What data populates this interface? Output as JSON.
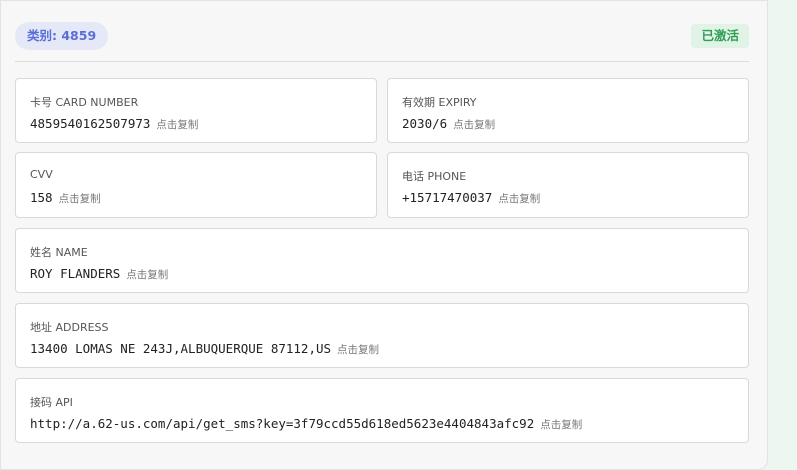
{
  "header": {
    "category": "类别: 4859",
    "status": "已激活"
  },
  "copy_hint": "点击复制",
  "fields": {
    "card_number": {
      "label": "卡号 CARD NUMBER",
      "value": "4859540162507973"
    },
    "expiry": {
      "label": "有效期 EXPIRY",
      "value": "2030/6"
    },
    "cvv": {
      "label": "CVV",
      "value": "158"
    },
    "phone": {
      "label": "电话 PHONE",
      "value": "+15717470037"
    },
    "name": {
      "label": "姓名 NAME",
      "value": "ROY FLANDERS"
    },
    "address": {
      "label": "地址 ADDRESS",
      "value": "13400 LOMAS NE 243J,ALBUQUERQUE 87112,US"
    },
    "api": {
      "label": "接码 API",
      "value": "http://a.62-us.com/api/get_sms?key=3f79ccd55d618ed5623e4404843afc92"
    }
  },
  "colors": {
    "accent": "#5a6fd6",
    "success": "#2f9e55"
  }
}
